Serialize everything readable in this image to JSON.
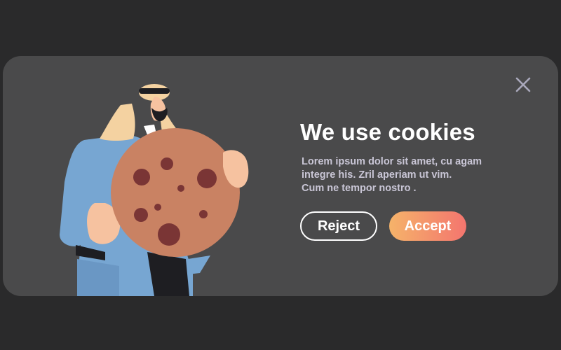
{
  "banner": {
    "title": "We use  cookies",
    "body_lines": [
      "Lorem ipsum dolor sit amet, cu agam",
      "integre his. Zril aperiam ut vim.",
      "Cum ne tempor nostro ."
    ],
    "reject_label": "Reject",
    "accept_label": "Accept",
    "close_icon": "close-icon",
    "illustration_icon": "man-holding-cookie-illustration"
  },
  "colors": {
    "page_background": "#2a2a2b",
    "banner_background": "#4a4a4b",
    "title_text": "#ffffff",
    "body_text": "#c9c6d6",
    "accept_gradient_start": "#f5b36a",
    "accept_gradient_end": "#f4756e",
    "cookie": "#c98263",
    "cookie_chip": "#7a3535"
  }
}
